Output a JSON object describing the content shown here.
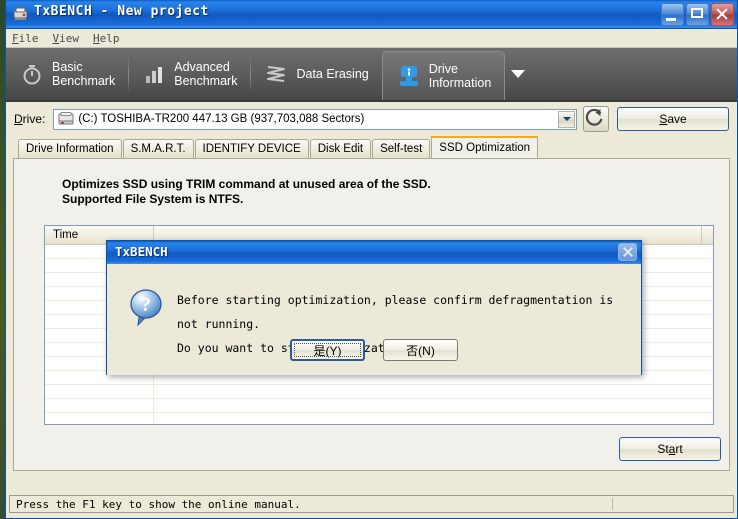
{
  "window": {
    "title": "TxBENCH - New project",
    "icon": "app-icon",
    "buttons": {
      "minimize": "minimize",
      "maximize": "maximize",
      "close": "close"
    }
  },
  "menu": {
    "items": [
      "File",
      "View",
      "Help"
    ]
  },
  "toolbar": {
    "items": [
      {
        "label": "Basic\nBenchmark",
        "icon": "stopwatch-icon",
        "active": false
      },
      {
        "label": "Advanced\nBenchmark",
        "icon": "bar-chart-icon",
        "active": false
      },
      {
        "label": "Data Erasing",
        "icon": "wave-icon",
        "active": false
      },
      {
        "label": "Drive\nInformation",
        "icon": "drive-info-icon",
        "active": true
      }
    ],
    "overflow": "overflow-chevron"
  },
  "drive": {
    "label": "Drive:",
    "label_accel": "D",
    "value": "(C:) TOSHIBA-TR200  447.13 GB (937,703,088 Sectors)",
    "icon": "hard-drive-icon",
    "refresh": "refresh-icon",
    "save_label": "Save",
    "save_accel": "S"
  },
  "tabs": [
    {
      "label": "Drive Information",
      "active": false
    },
    {
      "label": "S.M.A.R.T.",
      "active": false
    },
    {
      "label": "IDENTIFY DEVICE",
      "active": false
    },
    {
      "label": "Disk Edit",
      "active": false
    },
    {
      "label": "Self-test",
      "active": false
    },
    {
      "label": "SSD Optimization",
      "active": true
    }
  ],
  "panel": {
    "description": "Optimizes SSD using TRIM command at unused area of the SSD.\nSupported File System is NTFS.",
    "list": {
      "columns": [
        "Time",
        ""
      ],
      "rows": []
    },
    "start_label": "Start",
    "start_accel": "a"
  },
  "statusbar": {
    "message": "Press the F1 key to show the online manual."
  },
  "dialog": {
    "title": "TxBENCH",
    "icon": "question-icon",
    "close": "close-icon",
    "line1": "Before starting optimization, please confirm defragmentation is not running.",
    "line2": "Do you want to start optimization?",
    "yes_label": "是(Y)",
    "no_label": "否(N)"
  },
  "colors": {
    "titlebar_blue": "#1159bd",
    "active_tab_accent": "#f5a623",
    "toolbar_gray": "#5c5c5c",
    "accent_icon_blue": "#2f9ae8",
    "window_face": "#ece9d8"
  }
}
